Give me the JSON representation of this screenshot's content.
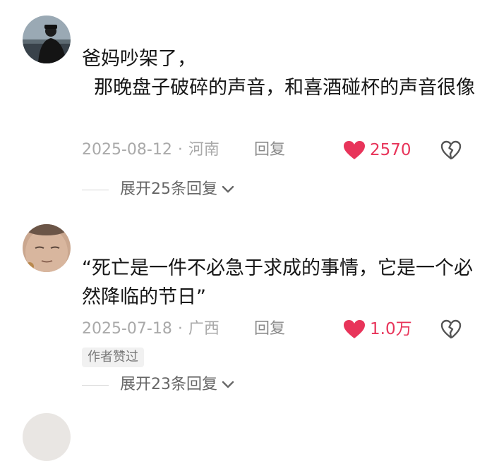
{
  "comments": [
    {
      "text": "爸妈吵架了，\n  那晚盘子破碎的声音，和喜酒碰杯的声音很像",
      "date": "2025-08-12",
      "separator": "·",
      "location": "河南",
      "reply_label": "回复",
      "likes": "2570",
      "expand_label": "展开25条回复"
    },
    {
      "text": "“死亡是一件不必急于求成的事情，它是一个必然降临的节日”",
      "date": "2025-07-18",
      "separator": "·",
      "location": "广西",
      "reply_label": "回复",
      "likes": "1.0万",
      "author_badge": "作者赞过",
      "expand_label": "展开23条回复"
    }
  ],
  "colors": {
    "like_red": "#e8345a",
    "meta_gray": "#a9a9a9",
    "badge_bg": "#f1f1f1"
  },
  "icons": {
    "like": "heart-filled-icon",
    "dislike": "broken-heart-icon",
    "expand": "chevron-down-icon"
  }
}
